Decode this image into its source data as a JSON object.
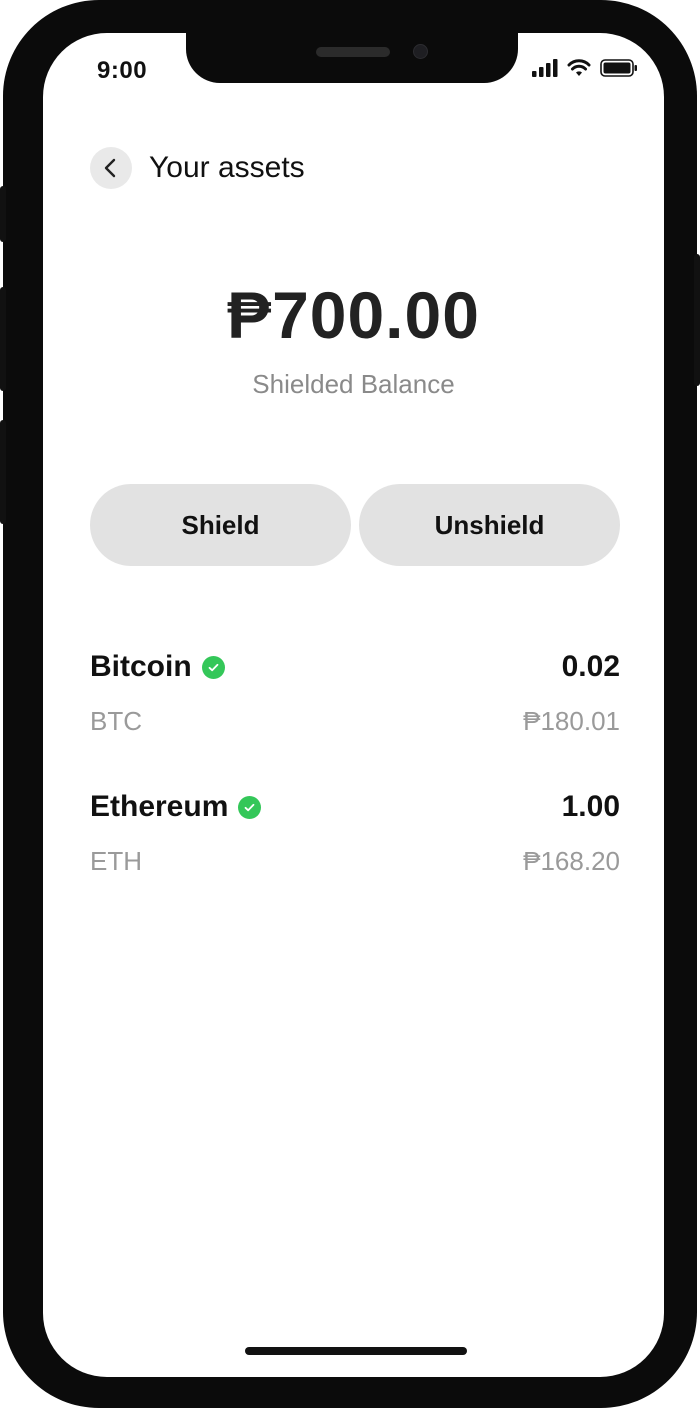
{
  "status_bar": {
    "time": "9:00"
  },
  "header": {
    "title": "Your assets"
  },
  "balance": {
    "amount": "₱700.00",
    "label": "Shielded Balance"
  },
  "actions": {
    "shield_label": "Shield",
    "unshield_label": "Unshield"
  },
  "assets": [
    {
      "name": "Bitcoin",
      "symbol": "BTC",
      "amount": "0.02",
      "fiat": "₱180.01",
      "verified": true
    },
    {
      "name": "Ethereum",
      "symbol": "ETH",
      "amount": "1.00",
      "fiat": "₱168.20",
      "verified": true
    }
  ],
  "colors": {
    "verified": "#34c759",
    "pill_bg": "#e2e2e2",
    "muted_text": "#8a8a8a"
  }
}
